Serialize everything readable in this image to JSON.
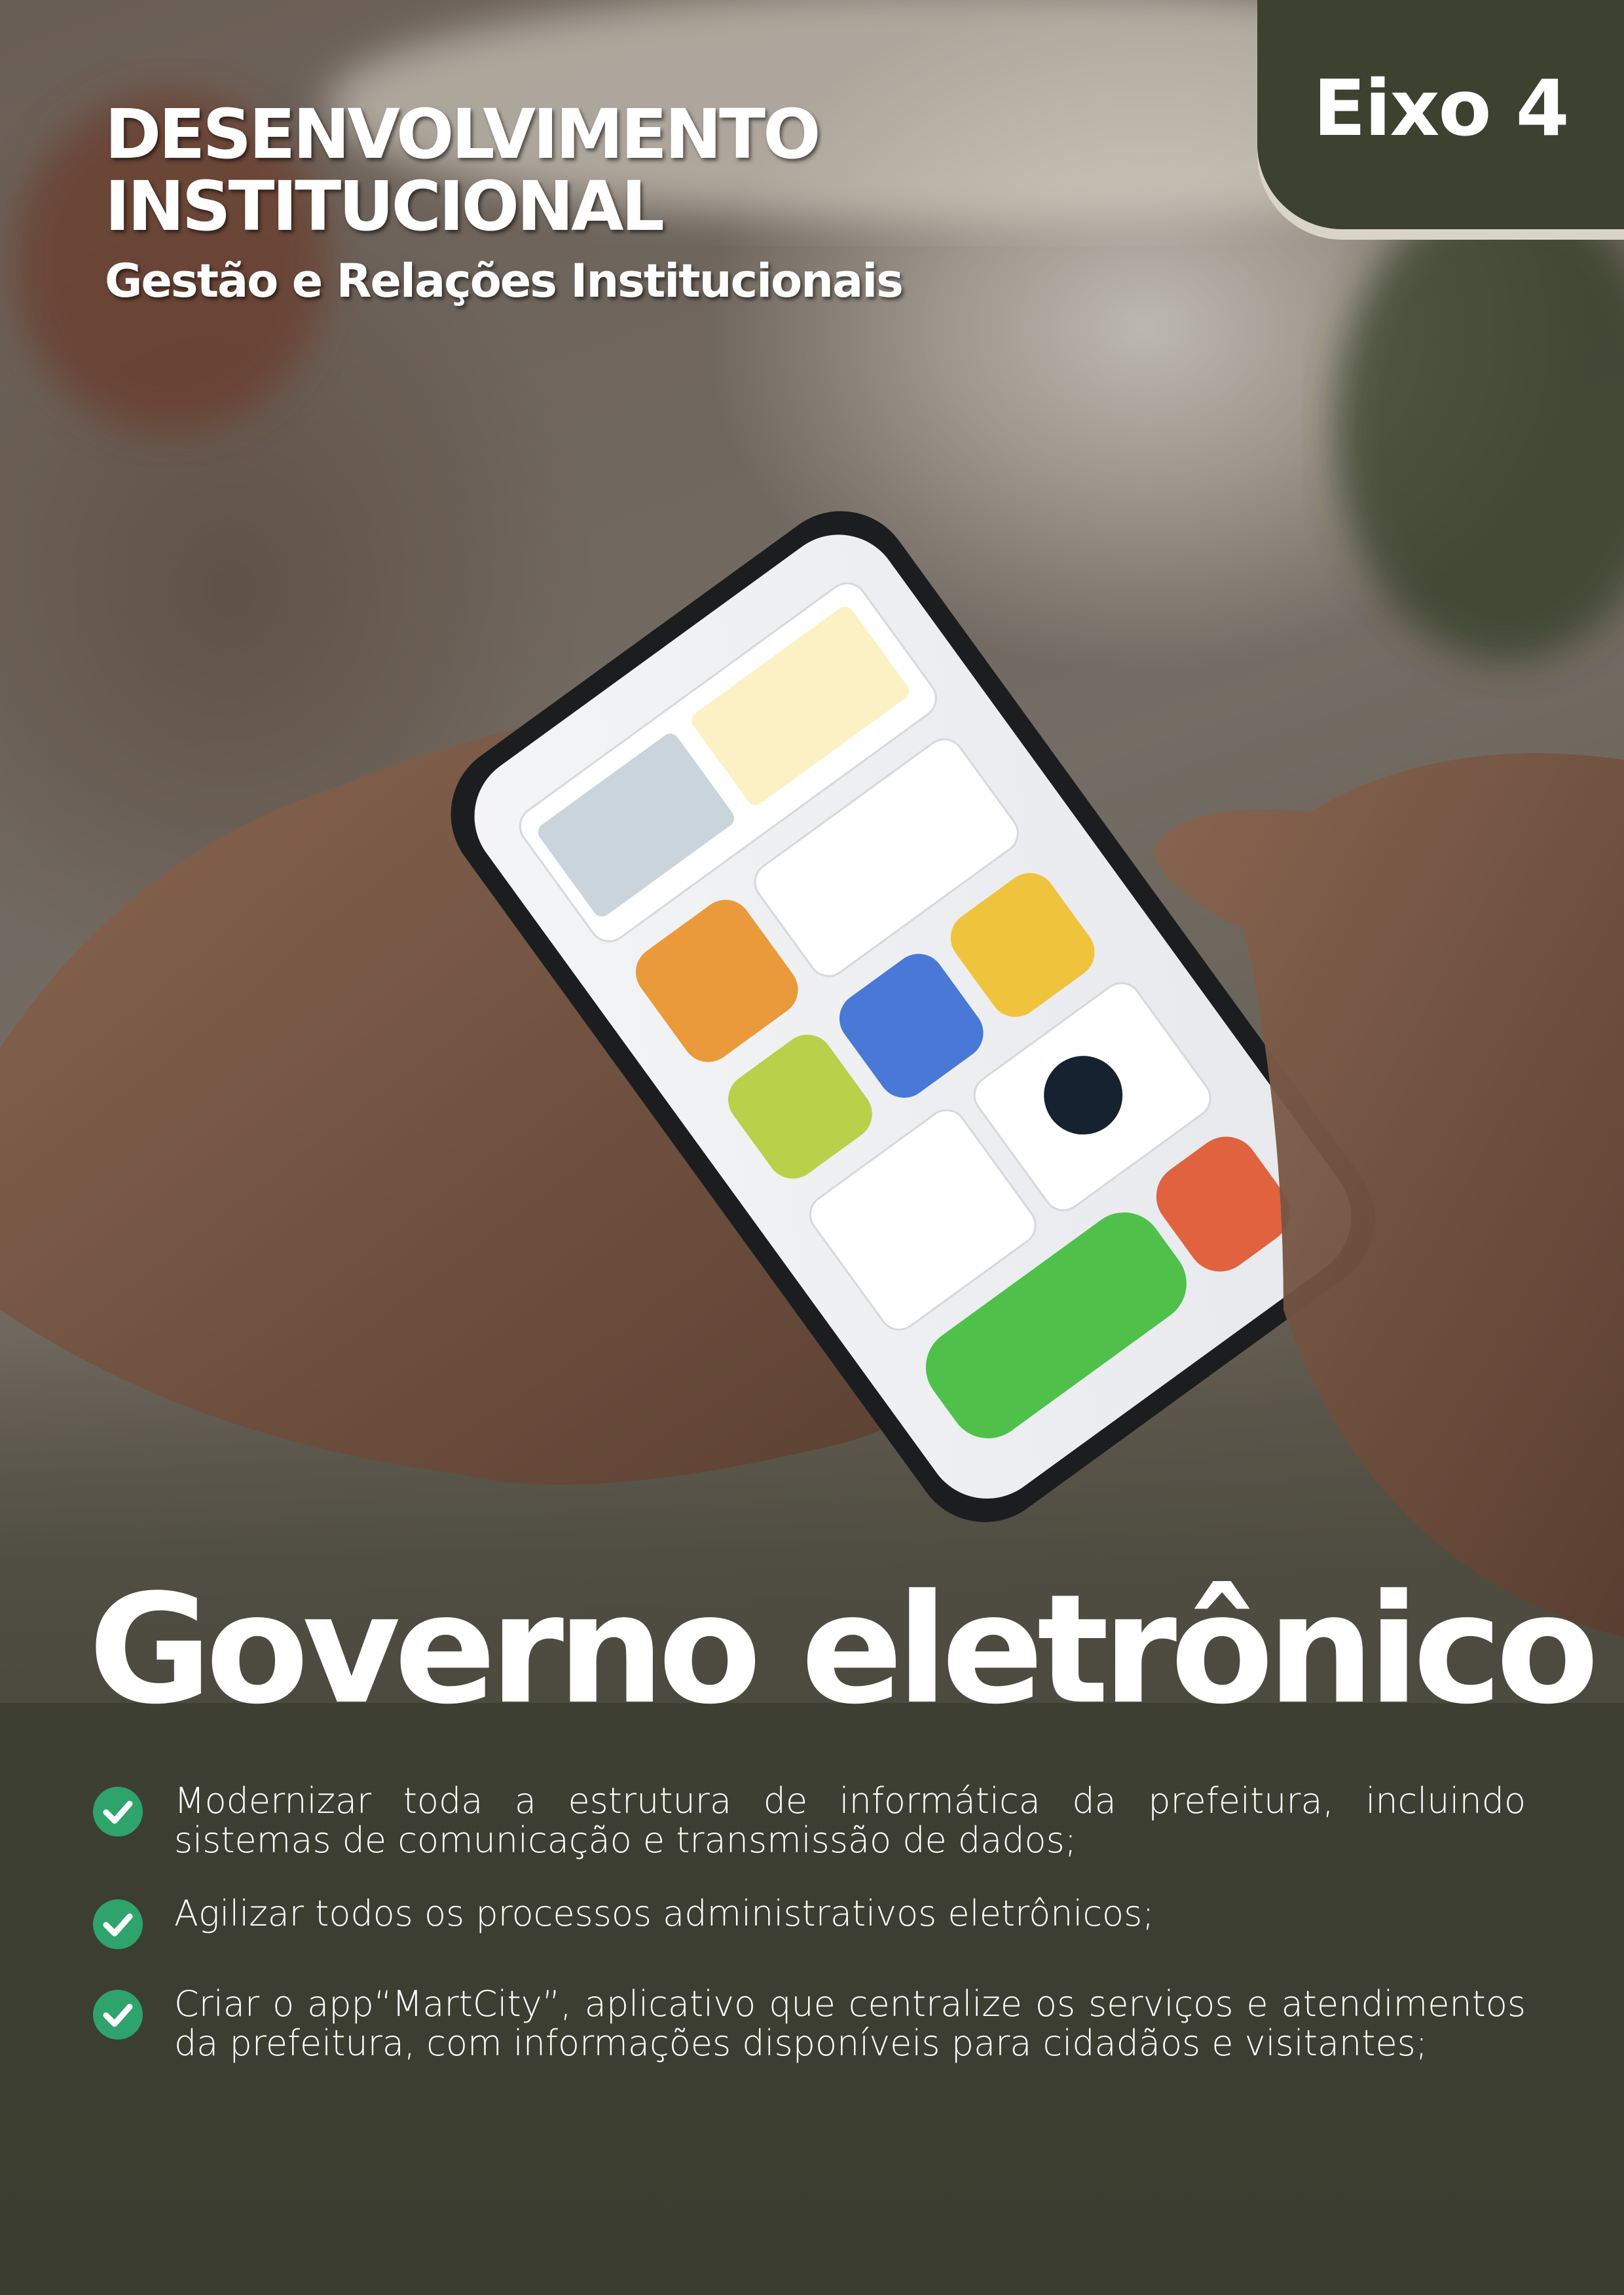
{
  "header": {
    "title_line1": "DESENVOLVIMENTO",
    "title_line2": "INSTITUCIONAL",
    "subtitle": "Gestão e Relações Institucionais"
  },
  "badge": {
    "label": "Eixo 4"
  },
  "main": {
    "title": "Governo eletrônico",
    "bullets": [
      {
        "text": "Modernizar toda a estrutura de informática da prefeitura, incluindo sistemas de comunicação e transmissão de dados;"
      },
      {
        "text": "Agilizar todos os processos administrativos eletrônicos;"
      },
      {
        "text": "Criar o app“MartCity”, aplicativo que centralize os serviços e atendimentos da prefeitura, com informações disponíveis para cidadãos e visitantes;"
      }
    ]
  },
  "colors": {
    "background": "#3d3f32",
    "badge": "#3d4230",
    "check": "#2ea36b",
    "text": "#ffffff"
  },
  "icons": {
    "bullet": "check-circle-icon"
  }
}
